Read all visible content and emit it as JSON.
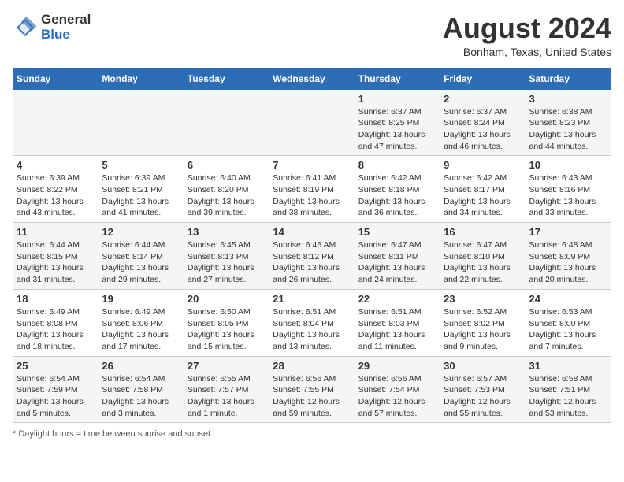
{
  "header": {
    "logo_line1": "General",
    "logo_line2": "Blue",
    "month_year": "August 2024",
    "location": "Bonham, Texas, United States"
  },
  "weekdays": [
    "Sunday",
    "Monday",
    "Tuesday",
    "Wednesday",
    "Thursday",
    "Friday",
    "Saturday"
  ],
  "footer": {
    "note": "Daylight hours"
  },
  "weeks": [
    [
      {
        "day": "",
        "info": ""
      },
      {
        "day": "",
        "info": ""
      },
      {
        "day": "",
        "info": ""
      },
      {
        "day": "",
        "info": ""
      },
      {
        "day": "1",
        "info": "Sunrise: 6:37 AM\nSunset: 8:25 PM\nDaylight: 13 hours\nand 47 minutes."
      },
      {
        "day": "2",
        "info": "Sunrise: 6:37 AM\nSunset: 8:24 PM\nDaylight: 13 hours\nand 46 minutes."
      },
      {
        "day": "3",
        "info": "Sunrise: 6:38 AM\nSunset: 8:23 PM\nDaylight: 13 hours\nand 44 minutes."
      }
    ],
    [
      {
        "day": "4",
        "info": "Sunrise: 6:39 AM\nSunset: 8:22 PM\nDaylight: 13 hours\nand 43 minutes."
      },
      {
        "day": "5",
        "info": "Sunrise: 6:39 AM\nSunset: 8:21 PM\nDaylight: 13 hours\nand 41 minutes."
      },
      {
        "day": "6",
        "info": "Sunrise: 6:40 AM\nSunset: 8:20 PM\nDaylight: 13 hours\nand 39 minutes."
      },
      {
        "day": "7",
        "info": "Sunrise: 6:41 AM\nSunset: 8:19 PM\nDaylight: 13 hours\nand 38 minutes."
      },
      {
        "day": "8",
        "info": "Sunrise: 6:42 AM\nSunset: 8:18 PM\nDaylight: 13 hours\nand 36 minutes."
      },
      {
        "day": "9",
        "info": "Sunrise: 6:42 AM\nSunset: 8:17 PM\nDaylight: 13 hours\nand 34 minutes."
      },
      {
        "day": "10",
        "info": "Sunrise: 6:43 AM\nSunset: 8:16 PM\nDaylight: 13 hours\nand 33 minutes."
      }
    ],
    [
      {
        "day": "11",
        "info": "Sunrise: 6:44 AM\nSunset: 8:15 PM\nDaylight: 13 hours\nand 31 minutes."
      },
      {
        "day": "12",
        "info": "Sunrise: 6:44 AM\nSunset: 8:14 PM\nDaylight: 13 hours\nand 29 minutes."
      },
      {
        "day": "13",
        "info": "Sunrise: 6:45 AM\nSunset: 8:13 PM\nDaylight: 13 hours\nand 27 minutes."
      },
      {
        "day": "14",
        "info": "Sunrise: 6:46 AM\nSunset: 8:12 PM\nDaylight: 13 hours\nand 26 minutes."
      },
      {
        "day": "15",
        "info": "Sunrise: 6:47 AM\nSunset: 8:11 PM\nDaylight: 13 hours\nand 24 minutes."
      },
      {
        "day": "16",
        "info": "Sunrise: 6:47 AM\nSunset: 8:10 PM\nDaylight: 13 hours\nand 22 minutes."
      },
      {
        "day": "17",
        "info": "Sunrise: 6:48 AM\nSunset: 8:09 PM\nDaylight: 13 hours\nand 20 minutes."
      }
    ],
    [
      {
        "day": "18",
        "info": "Sunrise: 6:49 AM\nSunset: 8:08 PM\nDaylight: 13 hours\nand 18 minutes."
      },
      {
        "day": "19",
        "info": "Sunrise: 6:49 AM\nSunset: 8:06 PM\nDaylight: 13 hours\nand 17 minutes."
      },
      {
        "day": "20",
        "info": "Sunrise: 6:50 AM\nSunset: 8:05 PM\nDaylight: 13 hours\nand 15 minutes."
      },
      {
        "day": "21",
        "info": "Sunrise: 6:51 AM\nSunset: 8:04 PM\nDaylight: 13 hours\nand 13 minutes."
      },
      {
        "day": "22",
        "info": "Sunrise: 6:51 AM\nSunset: 8:03 PM\nDaylight: 13 hours\nand 11 minutes."
      },
      {
        "day": "23",
        "info": "Sunrise: 6:52 AM\nSunset: 8:02 PM\nDaylight: 13 hours\nand 9 minutes."
      },
      {
        "day": "24",
        "info": "Sunrise: 6:53 AM\nSunset: 8:00 PM\nDaylight: 13 hours\nand 7 minutes."
      }
    ],
    [
      {
        "day": "25",
        "info": "Sunrise: 6:54 AM\nSunset: 7:59 PM\nDaylight: 13 hours\nand 5 minutes."
      },
      {
        "day": "26",
        "info": "Sunrise: 6:54 AM\nSunset: 7:58 PM\nDaylight: 13 hours\nand 3 minutes."
      },
      {
        "day": "27",
        "info": "Sunrise: 6:55 AM\nSunset: 7:57 PM\nDaylight: 13 hours\nand 1 minute."
      },
      {
        "day": "28",
        "info": "Sunrise: 6:56 AM\nSunset: 7:55 PM\nDaylight: 12 hours\nand 59 minutes."
      },
      {
        "day": "29",
        "info": "Sunrise: 6:56 AM\nSunset: 7:54 PM\nDaylight: 12 hours\nand 57 minutes."
      },
      {
        "day": "30",
        "info": "Sunrise: 6:57 AM\nSunset: 7:53 PM\nDaylight: 12 hours\nand 55 minutes."
      },
      {
        "day": "31",
        "info": "Sunrise: 6:58 AM\nSunset: 7:51 PM\nDaylight: 12 hours\nand 53 minutes."
      }
    ]
  ]
}
